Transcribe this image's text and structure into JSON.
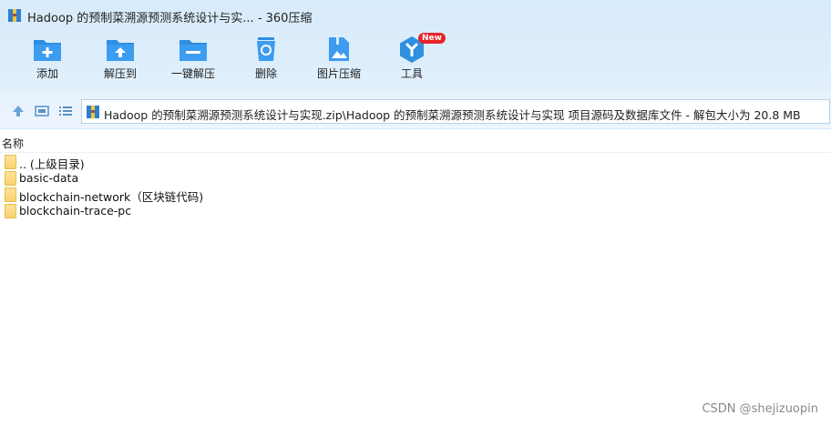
{
  "window": {
    "title": "Hadoop 的预制菜溯源预测系统设计与实... - 360压缩"
  },
  "toolbar": {
    "items": [
      {
        "label": "添加",
        "icon": "folder-add-icon"
      },
      {
        "label": "解压到",
        "icon": "folder-extract-icon"
      },
      {
        "label": "一键解压",
        "icon": "folder-one-click-icon"
      },
      {
        "label": "删除",
        "icon": "recycle-bin-icon"
      },
      {
        "label": "图片压缩",
        "icon": "image-compress-icon"
      },
      {
        "label": "工具",
        "icon": "tools-icon",
        "badge": "New"
      }
    ]
  },
  "address": {
    "path": "Hadoop 的预制菜溯源预测系统设计与实现.zip\\Hadoop 的预制菜溯源预测系统设计与实现 项目源码及数据库文件 - 解包大小为 20.8 MB"
  },
  "columns": {
    "name": "名称"
  },
  "files": [
    {
      "name": ".. (上级目录)"
    },
    {
      "name": "basic-data"
    },
    {
      "name": "blockchain-network（区块链代码)"
    },
    {
      "name": "blockchain-trace-pc"
    }
  ],
  "watermark": "CSDN @shejizuopin",
  "colors": {
    "toolbar_blue": "#2f8fe0",
    "badge_red": "#e8232a",
    "folder_yellow": "#f8d36e"
  }
}
